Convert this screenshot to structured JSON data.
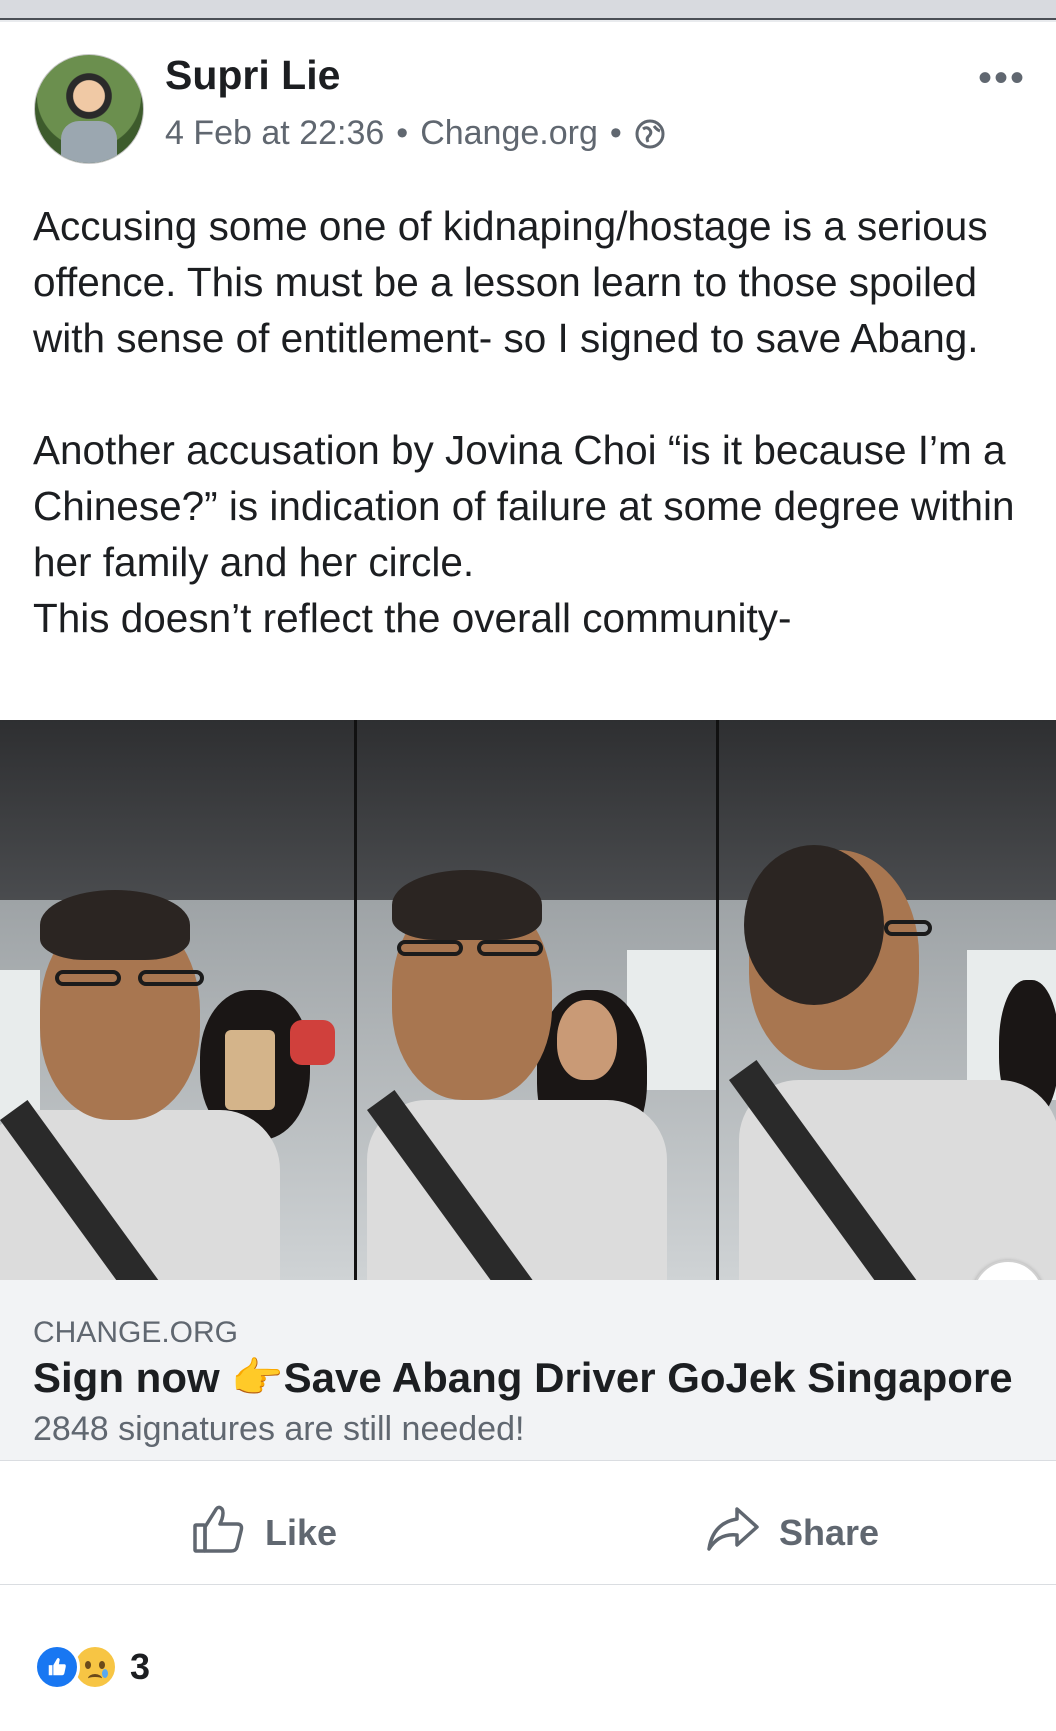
{
  "post": {
    "author": "Supri Lie",
    "date": "4 Feb at 22:36",
    "separator": "•",
    "source": "Change.org",
    "privacy_icon": "globe-icon",
    "more_icon": "more-options-icon",
    "paragraphs": [
      "Accusing some one of kidnaping/hostage is a serious offence. This must be a lesson learn to those spoiled with sense of entitlement- so I signed to save Abang.",
      "Another accusation by Jovina Choi  “is it because I’m a Chinese?” is indication of failure at some degree within her family and her circle.",
      "This doesn’t reflect the overall community-"
    ]
  },
  "link": {
    "domain": "CHANGE.ORG",
    "title_prefix": "Sign now ",
    "title_emoji": "👉",
    "title_rest": "Save Abang Driver GoJek Singapore",
    "description": "2848 signatures are still needed!"
  },
  "actions": {
    "like_label": "Like",
    "share_label": "Share"
  },
  "reactions": {
    "types": [
      "like",
      "sad"
    ],
    "count": "3"
  },
  "colors": {
    "brand_blue": "#1877f2",
    "secondary_text": "#606770",
    "card_bg": "#f2f3f5"
  }
}
